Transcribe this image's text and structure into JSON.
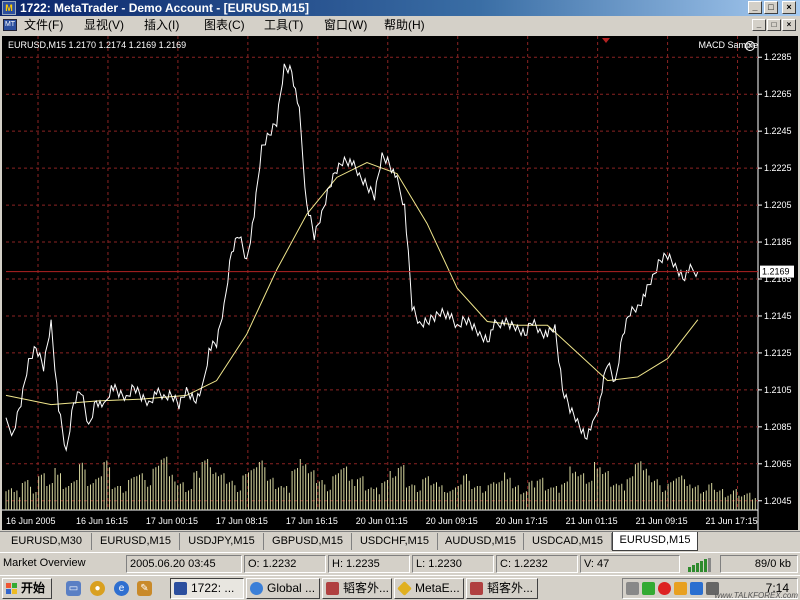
{
  "window": {
    "title": "1722: MetaTrader - Demo Account - [EURUSD,M15]",
    "app_icon": "metatrader-icon",
    "caption_buttons": [
      "_",
      "□",
      "×"
    ]
  },
  "menu": {
    "items": [
      "文件(F)",
      "显视(V)",
      "插入(I)",
      "图表(C)",
      "工具(T)",
      "窗口(W)",
      "帮助(H)"
    ],
    "mdi_buttons": [
      "_",
      "□",
      "×"
    ]
  },
  "chart": {
    "symbol_info": "EURUSD,M15  1.2170 1.2174 1.2169 1.2169",
    "indicator_label": "MACD Sample",
    "current_price": "1.2169",
    "background": "#000000",
    "grid_color": "#8b2323",
    "price_color": "#ffffff",
    "ma_color": "#f0e68c",
    "volume_color": "#d8d8a0",
    "price_line_color": "#b22222"
  },
  "chart_data": {
    "type": "line",
    "ylim": [
      1.204,
      1.229
    ],
    "y_ticks": [
      "1.2285",
      "1.2265",
      "1.2245",
      "1.2225",
      "1.2205",
      "1.2185",
      "1.2165",
      "1.2145",
      "1.2125",
      "1.2105",
      "1.2085",
      "1.2065",
      "1.2045"
    ],
    "x_ticks": [
      "16 Jun 2005",
      "16 Jun 16:15",
      "17 Jun 00:15",
      "17 Jun 08:15",
      "17 Jun 16:15",
      "20 Jun 01:15",
      "20 Jun 09:15",
      "20 Jun 17:15",
      "21 Jun 01:15",
      "21 Jun 09:15",
      "21 Jun 17:15"
    ],
    "current_price": 1.2169,
    "series": [
      {
        "name": "EURUSD",
        "type": "line",
        "x": [
          0,
          0.01,
          0.02,
          0.03,
          0.04,
          0.05,
          0.06,
          0.07,
          0.08,
          0.09,
          0.1,
          0.11,
          0.12,
          0.13,
          0.14,
          0.15,
          0.16,
          0.17,
          0.18,
          0.19,
          0.2,
          0.21,
          0.22,
          0.23,
          0.24,
          0.25,
          0.26,
          0.27,
          0.28,
          0.29,
          0.3,
          0.31,
          0.32,
          0.33,
          0.34,
          0.35,
          0.36,
          0.37,
          0.38,
          0.39,
          0.4,
          0.41,
          0.42,
          0.43,
          0.44,
          0.45,
          0.46,
          0.47,
          0.48,
          0.49,
          0.5,
          0.51,
          0.52,
          0.53,
          0.54,
          0.55,
          0.56,
          0.57,
          0.58,
          0.59,
          0.6,
          0.61,
          0.62,
          0.63,
          0.64,
          0.65,
          0.66,
          0.67,
          0.68,
          0.69,
          0.7,
          0.71,
          0.72,
          0.73,
          0.74,
          0.75,
          0.76,
          0.77,
          0.78,
          0.79,
          0.8,
          0.81,
          0.82,
          0.83,
          0.84,
          0.85,
          0.86,
          0.87,
          0.88,
          0.89,
          0.9,
          0.91,
          0.92
        ],
        "values": [
          1.2087,
          1.2082,
          1.2098,
          1.212,
          1.2128,
          1.2118,
          1.2142,
          1.2095,
          1.207,
          1.2098,
          1.2105,
          1.2085,
          1.21,
          1.2095,
          1.2107,
          1.2103,
          1.21,
          1.2107,
          1.2102,
          1.2098,
          1.2104,
          1.21,
          1.2102,
          1.2097,
          1.2105,
          1.21,
          1.2103,
          1.2127,
          1.213,
          1.215,
          1.218,
          1.219,
          1.2175,
          1.22,
          1.2235,
          1.2243,
          1.225,
          1.228,
          1.2278,
          1.2255,
          1.2205,
          1.2188,
          1.22,
          1.2215,
          1.2225,
          1.223,
          1.2228,
          1.222,
          1.2215,
          1.221,
          1.2232,
          1.2228,
          1.2218,
          1.2205,
          1.215,
          1.214,
          1.2142,
          1.2145,
          1.2148,
          1.2145,
          1.2138,
          1.2143,
          1.214,
          1.2135,
          1.2132,
          1.214,
          1.2142,
          1.214,
          1.2138,
          1.2135,
          1.2143,
          1.2137,
          1.2135,
          1.2138,
          1.2105,
          1.2095,
          1.2088,
          1.208,
          1.2085,
          1.21,
          1.212,
          1.2108,
          1.2135,
          1.2148,
          1.215,
          1.2157,
          1.2165,
          1.2175,
          1.2178,
          1.2172,
          1.2166,
          1.217,
          1.2169
        ]
      },
      {
        "name": "MA",
        "type": "line",
        "x": [
          0,
          0.06,
          0.12,
          0.18,
          0.24,
          0.28,
          0.32,
          0.36,
          0.4,
          0.44,
          0.48,
          0.52,
          0.56,
          0.6,
          0.64,
          0.68,
          0.72,
          0.76,
          0.8,
          0.84,
          0.88,
          0.92
        ],
        "values": [
          1.2102,
          1.2097,
          1.2099,
          1.21,
          1.2102,
          1.211,
          1.2135,
          1.217,
          1.22,
          1.222,
          1.2228,
          1.2222,
          1.2195,
          1.216,
          1.2142,
          1.214,
          1.214,
          1.2125,
          1.211,
          1.2112,
          1.2122,
          1.2143
        ]
      },
      {
        "name": "Volume",
        "type": "bar",
        "values": [
          30,
          22,
          38,
          26,
          44,
          35,
          52,
          28,
          40,
          58,
          33,
          46,
          62,
          30,
          27,
          39,
          48,
          36,
          55,
          71,
          42,
          34,
          29,
          48,
          66,
          52,
          44,
          38,
          29,
          46,
          57,
          61,
          40,
          33,
          28,
          54,
          63,
          48,
          39,
          30,
          45,
          58,
          36,
          42,
          31,
          26,
          38,
          47,
          55,
          33,
          29,
          41,
          37,
          28,
          24,
          35,
          44,
          30,
          27,
          32,
          38,
          46,
          29,
          25,
          34,
          40,
          31,
          28,
          36,
          53,
          44,
          38,
          60,
          48,
          35,
          30,
          42,
          66,
          51,
          39,
          28,
          34,
          45,
          37,
          29,
          26,
          31,
          25,
          22,
          24,
          20,
          18
        ]
      }
    ]
  },
  "tabs": {
    "items": [
      "EURUSD,M30",
      "EURUSD,M15",
      "USDJPY,M15",
      "GBPUSD,M15",
      "USDCHF,M15",
      "AUDUSD,M15",
      "USDCAD,M15",
      "EURUSD,M15"
    ],
    "active_index": 7
  },
  "status": {
    "profile": "Market Overview",
    "datetime": "2005.06.20 03:45",
    "open": "O: 1.2232",
    "high": "H: 1.2235",
    "low": "L: 1.2230",
    "close": "C: 1.2232",
    "volume": "V: 47",
    "traffic": "89/0 kb"
  },
  "taskbar": {
    "start_label": "开始",
    "buttons": [
      "1722: ...",
      "Global ...",
      "韬客外...",
      "MetaE...",
      "韬客外..."
    ],
    "active_index": 0,
    "clock": "7:14",
    "watermark": "www.TALKFOREX.com"
  }
}
